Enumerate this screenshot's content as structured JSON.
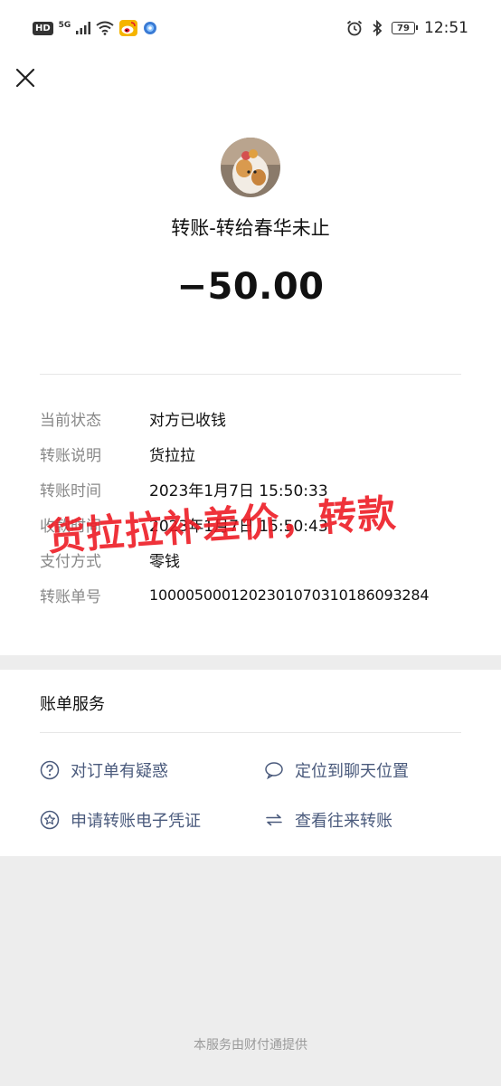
{
  "status_bar": {
    "hd": "HD",
    "network": "5G",
    "battery": "79",
    "time": "12:51"
  },
  "header": {
    "close_icon": "close-icon"
  },
  "transfer": {
    "title": "转账-转给春华未止",
    "amount": "−50.00",
    "details": [
      {
        "label": "当前状态",
        "value": "对方已收钱"
      },
      {
        "label": "转账说明",
        "value": "货拉拉"
      },
      {
        "label": "转账时间",
        "value": "2023年1月7日 15:50:33"
      },
      {
        "label": "收款时间",
        "value": "2023年1月7日 15:50:43"
      },
      {
        "label": "支付方式",
        "value": "零钱"
      },
      {
        "label": "转账单号",
        "value": "1000050001202301070310186093284"
      }
    ]
  },
  "overlay": {
    "text": "货拉拉补差价，转款",
    "color": "#ee1c25"
  },
  "services": {
    "title": "账单服务",
    "items": [
      {
        "label": "对订单有疑惑",
        "icon": "question-circle-icon"
      },
      {
        "label": "定位到聊天位置",
        "icon": "chat-bubble-icon"
      },
      {
        "label": "申请转账电子凭证",
        "icon": "star-circle-icon"
      },
      {
        "label": "查看往来转账",
        "icon": "swap-arrows-icon"
      }
    ],
    "link_color": "#4a5a7c"
  },
  "footer": {
    "note": "本服务由财付通提供"
  }
}
